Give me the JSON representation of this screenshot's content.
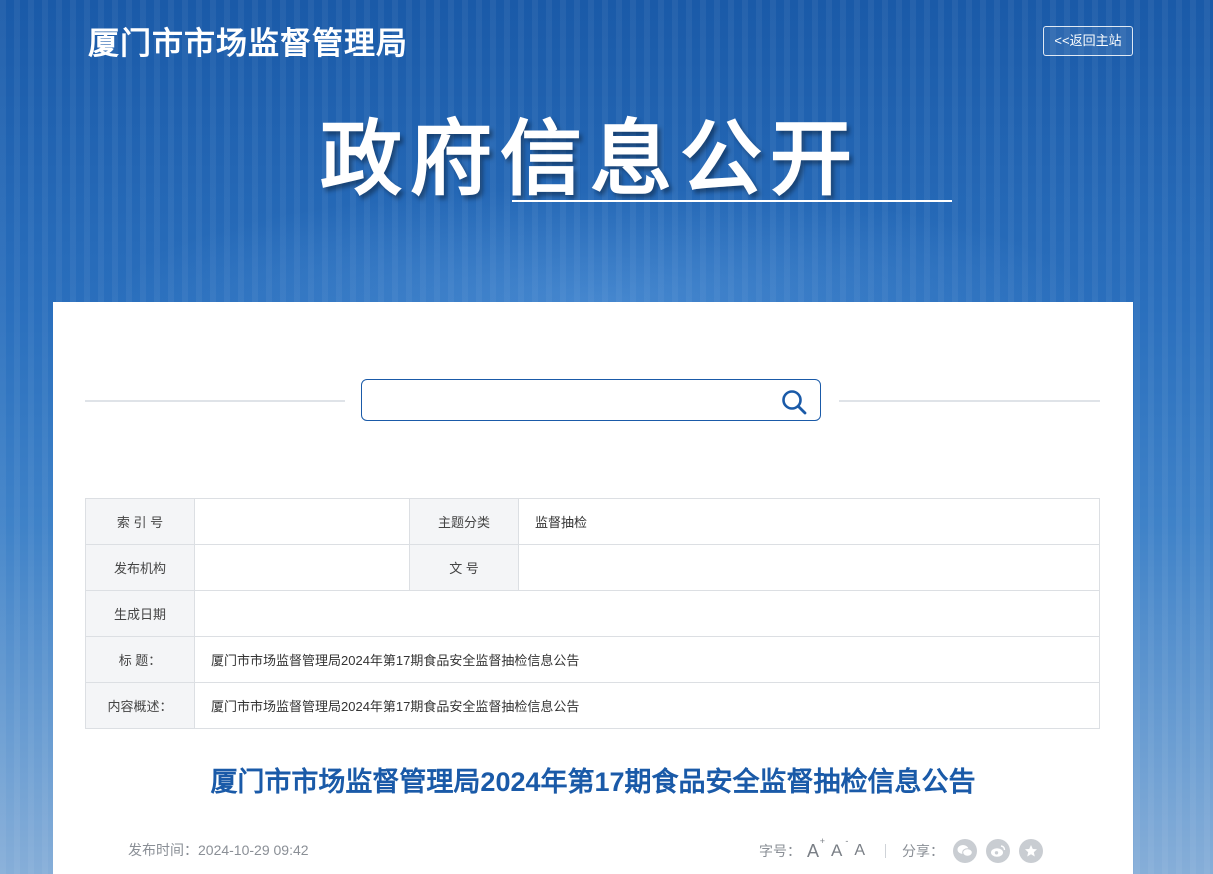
{
  "header": {
    "site_title": "厦门市市场监督管理局",
    "return_label": "<<返回主站"
  },
  "banner": {
    "title": "政府信息公开"
  },
  "search": {
    "placeholder": ""
  },
  "meta": {
    "index_label": "索 引 号",
    "index_value": "",
    "topic_label": "主题分类",
    "topic_value": "监督抽检",
    "publisher_label": "发布机构",
    "publisher_value": "",
    "docno_label": "文 号",
    "docno_value": "",
    "date_label": "生成日期",
    "date_value": "",
    "title_label": "标 题：",
    "title_value": "厦门市市场监督管理局2024年第17期食品安全监督抽检信息公告",
    "summary_label": "内容概述：",
    "summary_value": "厦门市市场监督管理局2024年第17期食品安全监督抽检信息公告"
  },
  "article": {
    "title": "厦门市市场监督管理局2024年第17期食品安全监督抽检信息公告",
    "publish_time": "发布时间：2024-10-29 09:42"
  },
  "tools": {
    "font_label": "字号：",
    "font_large": "A",
    "font_medium": "A",
    "font_small": "A",
    "share_label": "分享："
  },
  "colors": {
    "brand": "#1a5aa8",
    "panel": "#ffffff"
  }
}
